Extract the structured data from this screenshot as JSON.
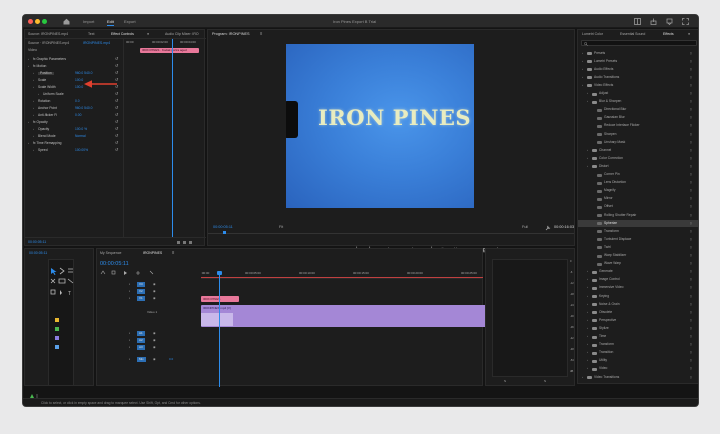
{
  "window": {
    "title": "Iron Pines Export B Trial"
  },
  "nav": {
    "import": "Import",
    "edit": "Edit",
    "export": "Export"
  },
  "effect_controls": {
    "tabs": [
      "Source: IRONPINES.mp4",
      "Text",
      "Effect Controls",
      "Audio Clip Mixer: IRO"
    ],
    "source_label": "Source · IRONPINES.mp4",
    "clip_label": "IRONPINES.mp4",
    "video_label": "Video",
    "clip_bar": "IRON PINES · Kodak portra aged",
    "times": [
      "00:00",
      "00:00:02:00",
      "00:00:04:00"
    ],
    "sections": [
      {
        "indent": 0,
        "label": "fx Graphic Parameters",
        "value": ""
      },
      {
        "indent": 0,
        "label": "fx Motion",
        "value": ""
      },
      {
        "indent": 1,
        "label": "Position",
        "value": "960.0   540.0"
      },
      {
        "indent": 1,
        "label": "Scale",
        "value": "100.0"
      },
      {
        "indent": 1,
        "label": "Scale Width",
        "value": "100.0"
      },
      {
        "indent": 2,
        "label": "Uniform Scale",
        "value": ""
      },
      {
        "indent": 1,
        "label": "Rotation",
        "value": "0.0"
      },
      {
        "indent": 1,
        "label": "Anchor Point",
        "value": "960.0   540.0"
      },
      {
        "indent": 1,
        "label": "Anti-flicker Fi",
        "value": "0.00"
      },
      {
        "indent": 0,
        "label": "fx Opacity",
        "value": ""
      },
      {
        "indent": 1,
        "label": "Opacity",
        "value": "100.0 %"
      },
      {
        "indent": 1,
        "label": "Blend Mode",
        "value": "Normal"
      },
      {
        "indent": 0,
        "label": "fx Time Remapping",
        "value": ""
      },
      {
        "indent": 1,
        "label": "Speed",
        "value": "100.00%"
      }
    ],
    "timecode": "00:00:05:11"
  },
  "program": {
    "title": "Program: IRONPINES",
    "frame_text": "IRON PINES",
    "timecode": "00:00:05:11",
    "fit": "Fit",
    "quality": "Full",
    "duration": "00:00:16:03"
  },
  "timeline": {
    "tabs": [
      "My Sequence",
      "IRONPINES"
    ],
    "timecode": "00:00:05:11",
    "ruler": [
      ":00:00",
      "00:00:05:00",
      "00:00:10:00",
      "00:00:15:00",
      "00:00:20:00",
      "00:00:25:00"
    ],
    "tracks": [
      "V3",
      "V2",
      "V1",
      "A1",
      "A2",
      "A3",
      "Mix"
    ],
    "v1_label": "Video 1",
    "title_clip": "IRON PINES",
    "video_clip": "IRONPINES.mp4 [V]",
    "mix_value": "0.0"
  },
  "meter": {
    "labels": [
      "0",
      "-6",
      "-12",
      "-18",
      "-24",
      "-30",
      "-36",
      "-42",
      "-48",
      "-54",
      "dB"
    ]
  },
  "effects": {
    "tabs": [
      "Lumetri Color",
      "Essential Sound",
      "Effects"
    ],
    "search_placeholder": "",
    "tree": [
      {
        "indent": 0,
        "type": "folder",
        "label": "Presets"
      },
      {
        "indent": 0,
        "type": "folder",
        "label": "Lumetri Presets"
      },
      {
        "indent": 0,
        "type": "folder",
        "label": "Audio Effects"
      },
      {
        "indent": 0,
        "type": "folder",
        "label": "Audio Transitions"
      },
      {
        "indent": 0,
        "type": "folder",
        "label": "Video Effects"
      },
      {
        "indent": 1,
        "type": "folder",
        "label": "Adjust"
      },
      {
        "indent": 1,
        "type": "folder",
        "label": "Blur & Sharpen"
      },
      {
        "indent": 2,
        "type": "fx",
        "label": "Directional Blur"
      },
      {
        "indent": 2,
        "type": "fx",
        "label": "Gaussian Blur"
      },
      {
        "indent": 2,
        "type": "fx",
        "label": "Reduce Interlace Flicker"
      },
      {
        "indent": 2,
        "type": "fx",
        "label": "Sharpen"
      },
      {
        "indent": 2,
        "type": "fx",
        "label": "Unsharp Mask"
      },
      {
        "indent": 1,
        "type": "folder",
        "label": "Channel"
      },
      {
        "indent": 1,
        "type": "folder",
        "label": "Color Correction"
      },
      {
        "indent": 1,
        "type": "folder",
        "label": "Distort"
      },
      {
        "indent": 2,
        "type": "fx",
        "label": "Corner Pin"
      },
      {
        "indent": 2,
        "type": "fx",
        "label": "Lens Distortion"
      },
      {
        "indent": 2,
        "type": "fx",
        "label": "Magnify"
      },
      {
        "indent": 2,
        "type": "fx",
        "label": "Mirror"
      },
      {
        "indent": 2,
        "type": "fx",
        "label": "Offset"
      },
      {
        "indent": 2,
        "type": "fx",
        "label": "Rolling Shutter Repair"
      },
      {
        "indent": 2,
        "type": "fx",
        "label": "Spherize",
        "selected": true
      },
      {
        "indent": 2,
        "type": "fx",
        "label": "Transform"
      },
      {
        "indent": 2,
        "type": "fx",
        "label": "Turbulent Displace"
      },
      {
        "indent": 2,
        "type": "fx",
        "label": "Twirl"
      },
      {
        "indent": 2,
        "type": "fx",
        "label": "Warp Stabilizer"
      },
      {
        "indent": 2,
        "type": "fx",
        "label": "Wave Warp"
      },
      {
        "indent": 1,
        "type": "folder",
        "label": "Generate"
      },
      {
        "indent": 1,
        "type": "folder",
        "label": "Image Control"
      },
      {
        "indent": 1,
        "type": "folder",
        "label": "Immersive Video"
      },
      {
        "indent": 1,
        "type": "folder",
        "label": "Keying"
      },
      {
        "indent": 1,
        "type": "folder",
        "label": "Noise & Grain"
      },
      {
        "indent": 1,
        "type": "folder",
        "label": "Obsolete"
      },
      {
        "indent": 1,
        "type": "folder",
        "label": "Perspective"
      },
      {
        "indent": 1,
        "type": "folder",
        "label": "Stylize"
      },
      {
        "indent": 1,
        "type": "folder",
        "label": "Time"
      },
      {
        "indent": 1,
        "type": "folder",
        "label": "Transform"
      },
      {
        "indent": 1,
        "type": "folder",
        "label": "Transition"
      },
      {
        "indent": 1,
        "type": "folder",
        "label": "Utility"
      },
      {
        "indent": 1,
        "type": "folder",
        "label": "Video"
      },
      {
        "indent": 0,
        "type": "folder",
        "label": "Video Transitions"
      }
    ]
  },
  "status": {
    "text": "Click to select, or click in empty space and drag to marquee select. Use Shift, Opt, and Cmd for other options."
  },
  "colors": {
    "accent": "#2d8ceb",
    "clip_pink": "#e8789a",
    "clip_purple": "#a487d6",
    "frame_blue": "#3d84dc",
    "title_text": "#e8ecc0",
    "arrow": "#e0402e"
  }
}
